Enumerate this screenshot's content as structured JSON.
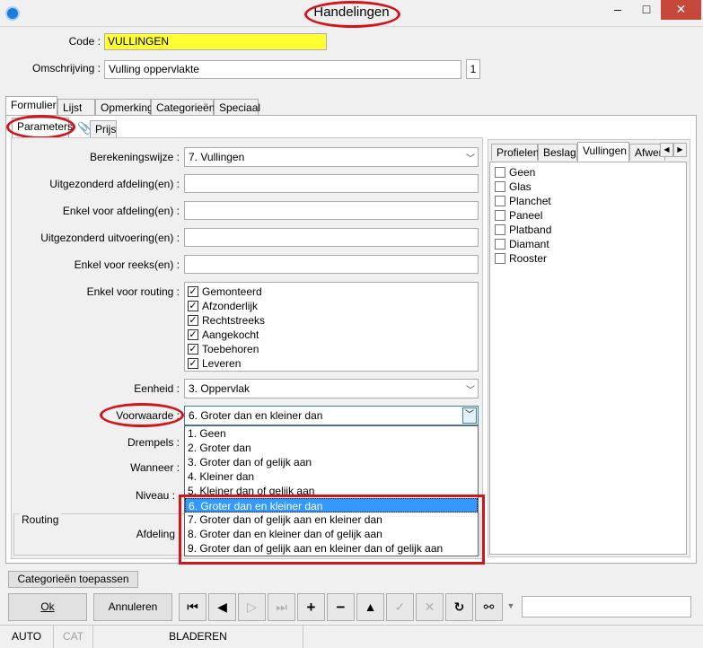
{
  "window": {
    "title": "Handelingen",
    "minimize": "–",
    "maximize": "□",
    "close": "✕"
  },
  "header": {
    "code_label": "Code :",
    "code_value": "VULLINGEN",
    "omschrijving_label": "Omschrijving :",
    "omschrijving_value": "Vulling oppervlakte",
    "omschrijving_count": "1"
  },
  "main_tabs": [
    "Formulier",
    "Lijst",
    "Opmerking",
    "Categorieën",
    "Speciaal"
  ],
  "sub_tabs": [
    "Parameters",
    "Prijs"
  ],
  "form": {
    "berekeningswijze_label": "Berekeningswijze :",
    "berekeningswijze_value": "7.  Vullingen",
    "uitgez_afdeling_label": "Uitgezonderd afdeling(en) :",
    "enkel_afdeling_label": "Enkel voor afdeling(en) :",
    "uitgez_uitvoering_label": "Uitgezonderd uitvoering(en) :",
    "enkel_reeks_label": "Enkel voor reeks(en) :",
    "routing_label": "Enkel voor routing :",
    "routing_items": [
      "Gemonteerd",
      "Afzonderlijk",
      "Rechtstreeks",
      "Aangekocht",
      "Toebehoren",
      "Leveren"
    ],
    "eenheid_label": "Eenheid :",
    "eenheid_value": "3.  Oppervlak",
    "voorwaarde_label": "Voorwaarde :",
    "voorwaarde_value": "6.  Groter dan en kleiner dan",
    "drempels_label": "Drempels :",
    "wanneer_label": "Wanneer :",
    "niveau_label": "Niveau :",
    "routing_group_label": "Routing",
    "afdeling_label": "Afdeling"
  },
  "voorwaarde_options": [
    "1.  Geen",
    "2.  Groter dan",
    "3.  Groter dan of gelijk aan",
    "4.  Kleiner dan",
    "5.  Kleiner dan of gelijk aan",
    "6.  Groter dan en kleiner dan",
    "7.  Groter dan of gelijk aan en kleiner dan",
    "8.  Groter dan en kleiner dan of gelijk aan",
    "9.  Groter dan of gelijk aan en kleiner dan of gelijk aan"
  ],
  "right_tabs": [
    "Profielen",
    "Beslag",
    "Vullingen",
    "Afwerl"
  ],
  "right_items": [
    "Geen",
    "Glas",
    "Planchet",
    "Paneel",
    "Platband",
    "Diamant",
    "Rooster"
  ],
  "buttons": {
    "categorieen_toepassen": "Categorieën toepassen",
    "ok": "Ok",
    "annuleren": "Annuleren"
  },
  "status": {
    "auto": "AUTO",
    "cat": "CAT",
    "mode": "BLADEREN"
  }
}
